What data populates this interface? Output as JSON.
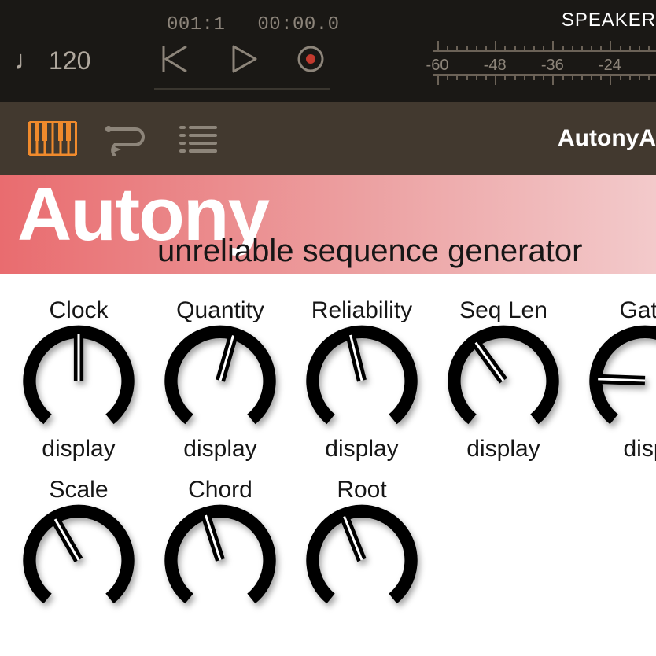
{
  "transport": {
    "bar_beat": "001:1",
    "time": "00:00.0",
    "speaker_label": "SPEAKER",
    "tempo": "120",
    "meter_ticks": [
      "-60",
      "-48",
      "-36",
      "-24"
    ]
  },
  "toolbar": {
    "plugin_name": "AutonyA"
  },
  "plugin": {
    "title": "Autony",
    "subtitle": "unreliable sequence generator",
    "knobs_row1": [
      {
        "label": "Clock",
        "value": "display",
        "angle": -90
      },
      {
        "label": "Quantity",
        "value": "display",
        "angle": -74
      },
      {
        "label": "Reliability",
        "value": "display",
        "angle": -104
      },
      {
        "label": "Seq Len",
        "value": "display",
        "angle": -126
      },
      {
        "label": "Gate",
        "value": "disp",
        "angle": -178
      }
    ],
    "knobs_row2": [
      {
        "label": "Scale",
        "value": "",
        "angle": -120
      },
      {
        "label": "Chord",
        "value": "",
        "angle": -108
      },
      {
        "label": "Root",
        "value": "",
        "angle": -112
      }
    ]
  }
}
